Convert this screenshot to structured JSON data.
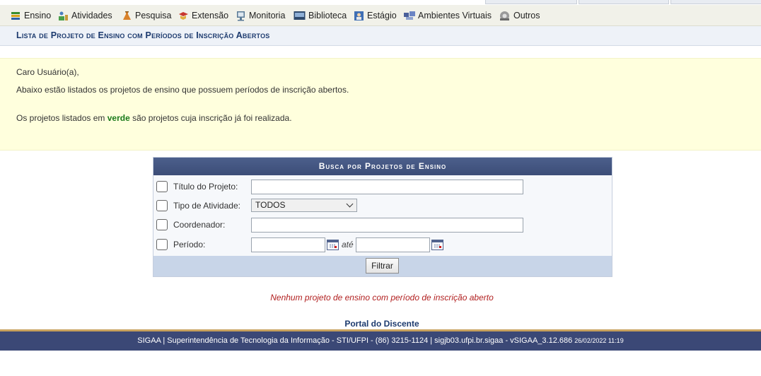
{
  "menu": {
    "items": [
      {
        "label": "Ensino",
        "icon": "ensino-icon",
        "color": "#3a8d2e"
      },
      {
        "label": "Atividades",
        "icon": "atividades-icon",
        "color": "#4a7fc1"
      },
      {
        "label": "Pesquisa",
        "icon": "pesquisa-icon",
        "color": "#d9822b"
      },
      {
        "label": "Extensão",
        "icon": "extensao-icon",
        "color": "#c8372d"
      },
      {
        "label": "Monitoria",
        "icon": "monitoria-icon",
        "color": "#5a7a96"
      },
      {
        "label": "Biblioteca",
        "icon": "biblioteca-icon",
        "color": "#2f4a6d"
      },
      {
        "label": "Estágio",
        "icon": "estagio-icon",
        "color": "#3f6fb5"
      },
      {
        "label": "Ambientes Virtuais",
        "icon": "ambientes-virtuais-icon",
        "color": "#4a5f9a"
      },
      {
        "label": "Outros",
        "icon": "outros-icon",
        "color": "#7a7a7a"
      }
    ]
  },
  "page": {
    "title": "Lista de Projeto de Ensino com Períodos de Inscrição Abertos"
  },
  "notice": {
    "greeting": "Caro Usuário(a),",
    "line1": "Abaixo estão listados os projetos de ensino que possuem períodos de inscrição abertos.",
    "line2_prefix": "Os projetos listados em ",
    "line2_highlight": "verde",
    "line2_suffix": " são projetos cuja inscrição já foi realizada."
  },
  "form": {
    "caption": "Busca por Projetos de Ensino",
    "fields": {
      "titulo_label": "Título do Projeto:",
      "titulo_value": "",
      "tipo_label": "Tipo de Atividade:",
      "tipo_selected": "TODOS",
      "coordenador_label": "Coordenador:",
      "coordenador_value": "",
      "periodo_label": "Período:",
      "periodo_inicio": "",
      "periodo_fim": "",
      "ate_label": "até"
    },
    "submit_label": "Filtrar"
  },
  "results": {
    "empty_message": "Nenhum projeto de ensino com período de inscrição aberto"
  },
  "links": {
    "portal": "Portal do Discente"
  },
  "footer": {
    "text": "SIGAA | Superintendência de Tecnologia da Informação - STI/UFPI - (86) 3215-1124 | sigjb03.ufpi.br.sigaa - vSIGAA_3.12.686",
    "timestamp": "26/02/2022 11:19"
  }
}
